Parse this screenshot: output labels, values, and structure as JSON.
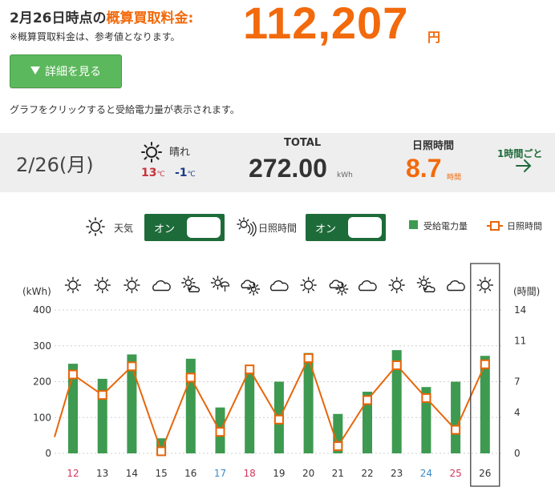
{
  "header": {
    "title_prefix": "2月26日時点の",
    "title_accent": "概算買取料金:",
    "note": "※概算買取料金は、参考値となります。",
    "amount": "112,207",
    "amount_unit": "円"
  },
  "detail_button": {
    "label": "詳細を見る",
    "icon": "triangle-down-icon"
  },
  "hint": "グラフをクリックすると受給電力量が表示されます。",
  "summary": {
    "date": "2/26(月)",
    "weather_icon": "sunny-icon",
    "weather_label": "晴れ",
    "temp_max": "13",
    "temp_min": "-1",
    "temp_unit": "℃",
    "total_label": "TOTAL",
    "total_value": "272.00",
    "total_unit": "kWh",
    "sunshine_label": "日照時間",
    "sunshine_value": "8.7",
    "sunshine_unit": "時間",
    "hourly_link": "1時間ごと"
  },
  "controls": {
    "weather_label": "天気",
    "weather_toggle": "オン",
    "sunshine_label": "日照時間",
    "sunshine_toggle": "オン",
    "legend_bar": "受給電力量",
    "legend_line": "日照時間"
  },
  "colors": {
    "accent": "#f26a0c",
    "green_button": "#5cb85c",
    "toggle_green": "#1e6b3a",
    "bar_green": "#3d9a50",
    "line_orange": "#e8650a",
    "weekend_sat": "#3a8ac8",
    "weekend_sun": "#d2365c"
  },
  "chart_data": {
    "type": "bar",
    "categories": [
      "12",
      "13",
      "14",
      "15",
      "16",
      "17",
      "18",
      "19",
      "20",
      "21",
      "22",
      "23",
      "24",
      "25",
      "26"
    ],
    "category_colors": [
      "sun",
      "normal",
      "normal",
      "normal",
      "normal",
      "sat",
      "sun",
      "normal",
      "normal",
      "normal",
      "normal",
      "normal",
      "sat",
      "sun",
      "normal"
    ],
    "weather": [
      "sunny",
      "sunny",
      "sunny",
      "cloudy",
      "sunny-cloudy",
      "sunny-rain",
      "cloudy-sunny",
      "cloudy",
      "sunny",
      "cloudy-sunny",
      "cloudy",
      "sunny",
      "sunny-cloudy",
      "cloudy",
      "sunny"
    ],
    "series": [
      {
        "name": "受給電力量",
        "values": [
          250,
          208,
          276,
          42,
          264,
          128,
          228,
          200,
          280,
          110,
          172,
          288,
          185,
          200,
          272
        ]
      },
      {
        "name": "日照時間",
        "values": [
          7.7,
          5.7,
          8.5,
          0.2,
          7.4,
          2.1,
          8.2,
          3.3,
          9.3,
          0.7,
          5.2,
          8.6,
          5.4,
          2.3,
          8.7
        ]
      }
    ],
    "left_axis": {
      "label": "(kWh)",
      "ticks": [
        0,
        100,
        200,
        300,
        400
      ],
      "ylim": [
        0,
        400
      ]
    },
    "right_axis": {
      "label": "(時間)",
      "ticks": [
        0,
        4,
        7,
        11,
        14
      ],
      "ylim": [
        0,
        14
      ]
    },
    "selected": "26",
    "grid": true
  }
}
